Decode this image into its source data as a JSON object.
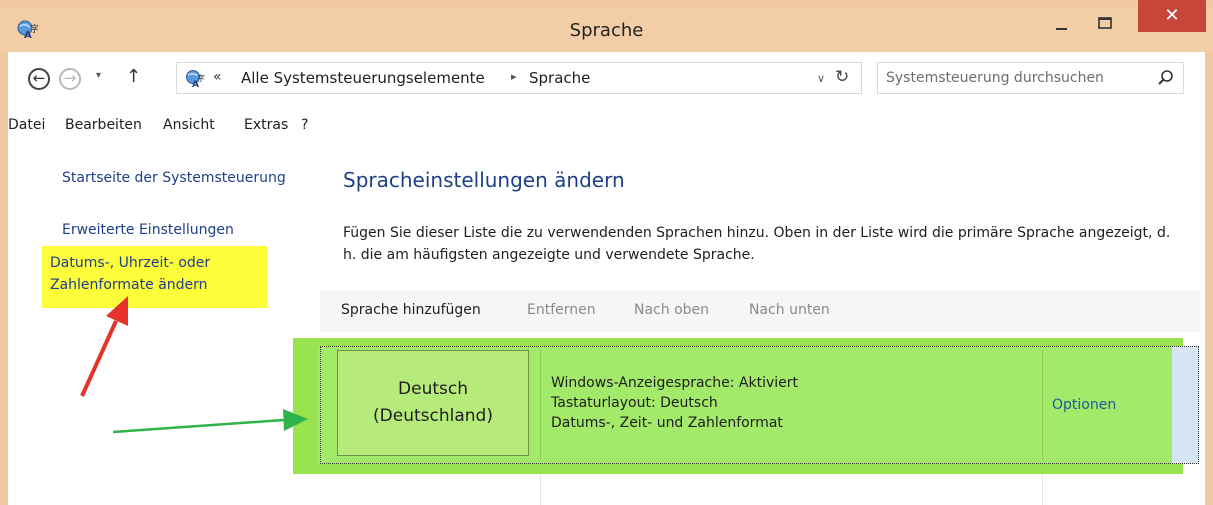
{
  "window": {
    "title": "Sprache",
    "close_glyph": "✕"
  },
  "icons": {
    "app": "control-panel-language-icon",
    "search": "search-icon",
    "refresh": "refresh-icon"
  },
  "nav": {
    "back_glyph": "←",
    "forward_glyph": "→",
    "dropdown_glyph": "▾",
    "up_glyph": "↑"
  },
  "address": {
    "prefix": "«",
    "crumbs": [
      "Alle Systemsteuerungselemente",
      "Sprache"
    ],
    "separator": "▸",
    "dropdown_glyph": "∨",
    "refresh_glyph": "↻"
  },
  "search": {
    "placeholder": "Systemsteuerung durchsuchen"
  },
  "menu": [
    "Datei",
    "Bearbeiten",
    "Ansicht",
    "Extras",
    "?"
  ],
  "sidebar": {
    "links": [
      "Startseite der Systemsteuerung",
      "Erweiterte Einstellungen"
    ],
    "highlighted_link_line1": "Datums-, Uhrzeit- oder",
    "highlighted_link_line2": "Zahlenformate ändern"
  },
  "main": {
    "title": "Spracheinstellungen ändern",
    "description": "Fügen Sie dieser Liste die zu verwendenden Sprachen hinzu. Oben in der Liste wird die primäre Sprache angezeigt, d. h. die am häufigsten angezeigte und verwendete Sprache.",
    "toolbar": {
      "add": "Sprache hinzufügen",
      "remove": "Entfernen",
      "up": "Nach oben",
      "down": "Nach unten"
    }
  },
  "language_row": {
    "name_line1": "Deutsch",
    "name_line2": "(Deutschland)",
    "info": [
      "Windows-Anzeigesprache: Aktiviert",
      "Tastaturlayout: Deutsch",
      "Datums-, Zeit- und Zahlenformat"
    ],
    "options": "Optionen"
  },
  "colors": {
    "titlebar": "#f3cda6",
    "close": "#c7463a",
    "link": "#1e3f8a",
    "highlight_yellow": "#fdfd3a",
    "highlight_green": "#98e34f",
    "arrow_red": "#e5322b",
    "arrow_green": "#2fb34a"
  }
}
